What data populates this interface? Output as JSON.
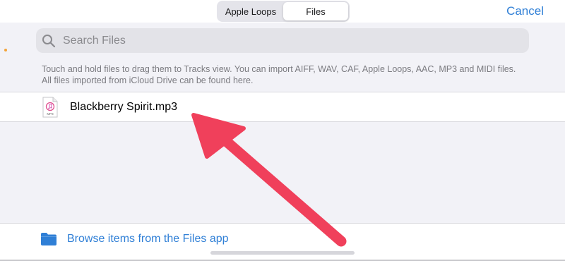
{
  "header": {
    "tabs": [
      {
        "label": "Apple Loops",
        "active": false
      },
      {
        "label": "Files",
        "active": true
      }
    ],
    "cancel_label": "Cancel"
  },
  "search": {
    "placeholder": "Search Files",
    "value": ""
  },
  "info_text": "Touch and hold files to drag them to Tracks view. You can import AIFF, WAV, CAF, Apple Loops, AAC, MP3 and MIDI files. All files imported from iCloud Drive can be found here.",
  "files": [
    {
      "name": "Blackberry Spirit.mp3",
      "icon": "mp3-file-icon",
      "icon_caption": "MP3"
    }
  ],
  "browse": {
    "label": "Browse items from the Files app",
    "icon": "folder-icon"
  },
  "colors": {
    "accent": "#2f7fd6",
    "annotation_arrow": "#f0405b",
    "background": "#f2f2f7"
  }
}
